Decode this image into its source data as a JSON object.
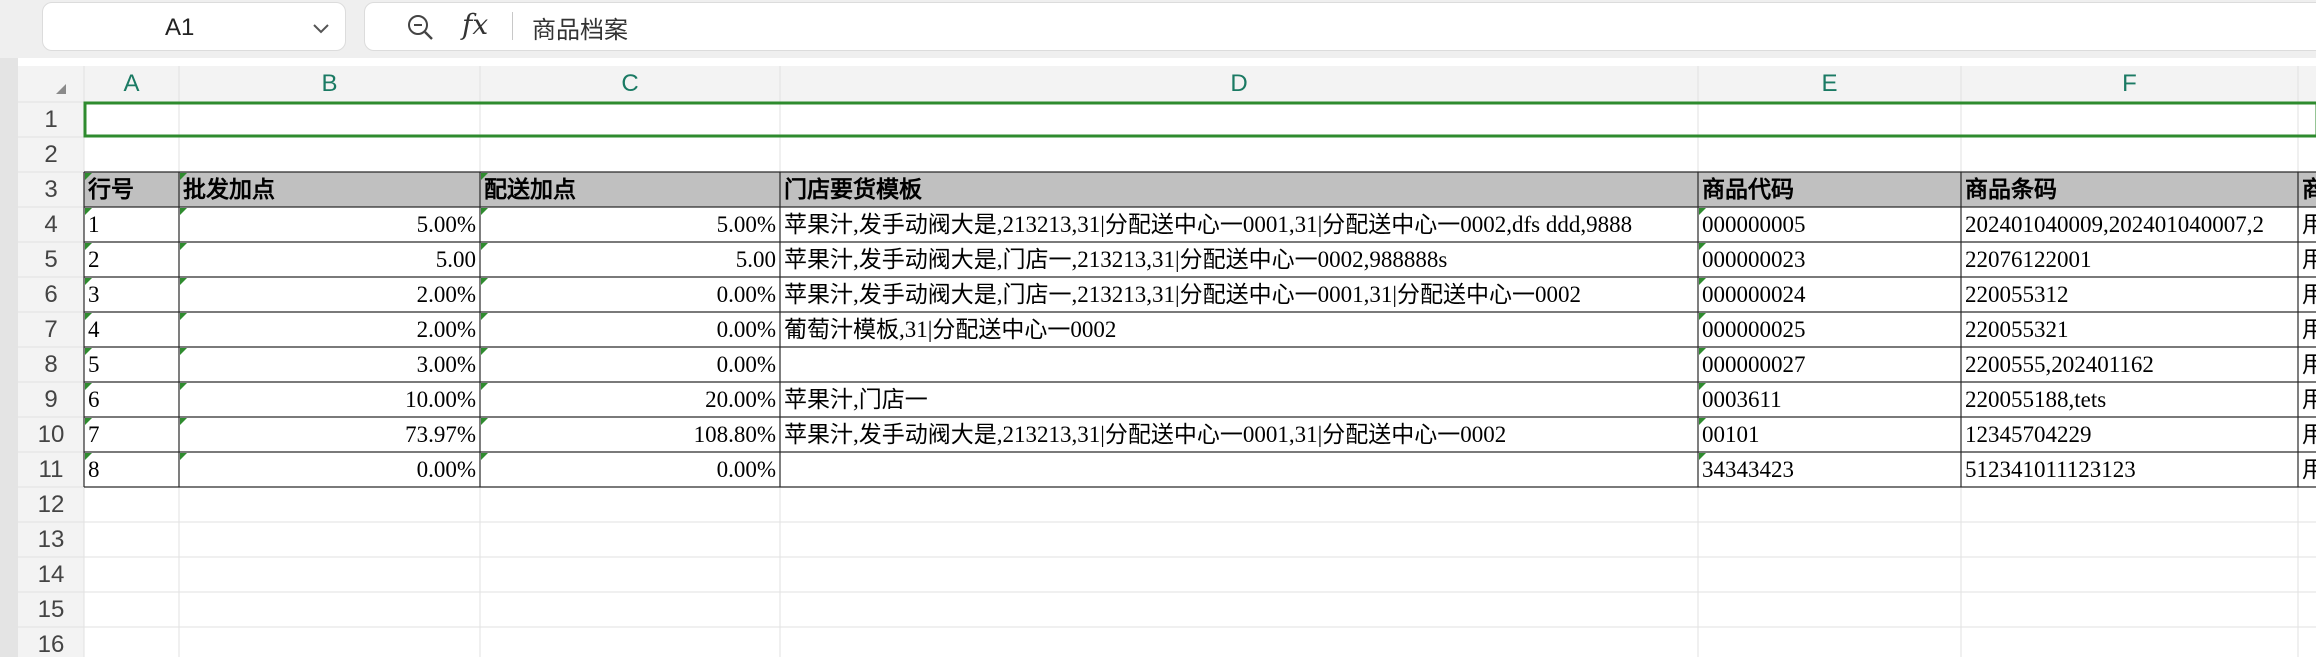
{
  "formula_bar": {
    "cell_ref": "A1",
    "formula_value": "商品档案",
    "fx_label": "fx"
  },
  "columns": [
    "A",
    "B",
    "C",
    "D",
    "E",
    "F"
  ],
  "row_numbers": [
    "1",
    "2",
    "3",
    "4",
    "5",
    "6",
    "7",
    "8",
    "9",
    "10",
    "11",
    "12",
    "13",
    "14",
    "15",
    "16"
  ],
  "table": {
    "headers": [
      "行号",
      "批发加点",
      "配送加点",
      "门店要货模板",
      "商品代码",
      "商品条码",
      "商"
    ],
    "rows": [
      [
        "1",
        "5.00%",
        "5.00%",
        "苹果汁,发手动阀大是,213213,31|分配送中心一0001,31|分配送中心一0002,dfs ddd,9888",
        "000000005",
        "202401040009,202401040007,2",
        "用"
      ],
      [
        "2",
        "5.00",
        "5.00",
        "苹果汁,发手动阀大是,门店一,213213,31|分配送中心一0002,988888s",
        "000000023",
        "22076122001",
        "用"
      ],
      [
        "3",
        "2.00%",
        "0.00%",
        "苹果汁,发手动阀大是,门店一,213213,31|分配送中心一0001,31|分配送中心一0002",
        "000000024",
        "220055312",
        "用"
      ],
      [
        "4",
        "2.00%",
        "0.00%",
        "葡萄汁模板,31|分配送中心一0002",
        "000000025",
        "220055321",
        "用"
      ],
      [
        "5",
        "3.00%",
        "0.00%",
        "",
        "000000027",
        "2200555,202401162",
        "用"
      ],
      [
        "6",
        "10.00%",
        "20.00%",
        "苹果汁,门店一",
        "0003611",
        "220055188,tets",
        "用"
      ],
      [
        "7",
        "73.97%",
        "108.80%",
        "苹果汁,发手动阀大是,213213,31|分配送中心一0001,31|分配送中心一0002",
        "00101",
        "12345704229",
        "用"
      ],
      [
        "8",
        "0.00%",
        "0.00%",
        "",
        "34343423",
        "512341011123123",
        "用"
      ]
    ]
  },
  "colors": {
    "header_fill": "#c0c0c0",
    "selection_border": "#2e8b2e",
    "column_letter": "#1a7a63",
    "gridline": "#e2e2e2"
  }
}
